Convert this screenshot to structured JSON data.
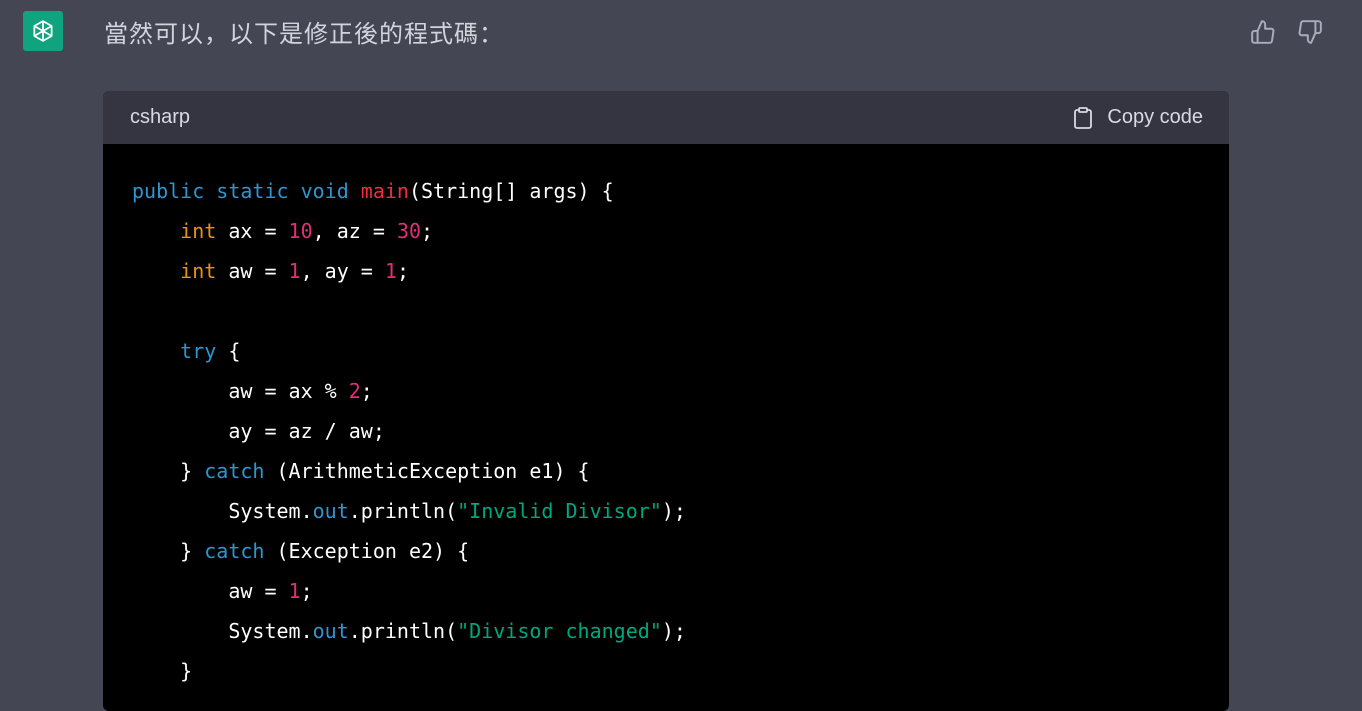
{
  "message": {
    "text": "當然可以，以下是修正後的程式碼："
  },
  "colors": {
    "avatar_bg": "#10a37f",
    "page_bg": "#444654",
    "header_bg": "#343541",
    "code_bg": "#000000"
  },
  "icons": {
    "avatar": "openai-logo-icon",
    "like": "thumbs-up-icon",
    "dislike": "thumbs-down-icon",
    "copy": "clipboard-icon"
  },
  "code_block": {
    "language": "csharp",
    "copy_label": "Copy code",
    "lines": [
      [
        {
          "t": "public static void",
          "c": "kw"
        },
        {
          "t": " "
        },
        {
          "t": "main",
          "c": "ty"
        },
        {
          "t": "(String[] args) {"
        }
      ],
      [
        {
          "t": "    "
        },
        {
          "t": "int",
          "c": "ty-int"
        },
        {
          "t": " ax = "
        },
        {
          "t": "10",
          "c": "num"
        },
        {
          "t": ", az = "
        },
        {
          "t": "30",
          "c": "num"
        },
        {
          "t": ";"
        }
      ],
      [
        {
          "t": "    "
        },
        {
          "t": "int",
          "c": "ty-int"
        },
        {
          "t": " aw = "
        },
        {
          "t": "1",
          "c": "num"
        },
        {
          "t": ", ay = "
        },
        {
          "t": "1",
          "c": "num"
        },
        {
          "t": ";"
        }
      ],
      [
        {
          "t": ""
        }
      ],
      [
        {
          "t": "    "
        },
        {
          "t": "try",
          "c": "kw"
        },
        {
          "t": " {"
        }
      ],
      [
        {
          "t": "        aw = ax % "
        },
        {
          "t": "2",
          "c": "num"
        },
        {
          "t": ";"
        }
      ],
      [
        {
          "t": "        ay = az / aw;"
        }
      ],
      [
        {
          "t": "    } "
        },
        {
          "t": "catch",
          "c": "kw"
        },
        {
          "t": " (ArithmeticException e1) {"
        }
      ],
      [
        {
          "t": "        System."
        },
        {
          "t": "out",
          "c": "kw"
        },
        {
          "t": ".println("
        },
        {
          "t": "\"Invalid Divisor\"",
          "c": "str"
        },
        {
          "t": ");"
        }
      ],
      [
        {
          "t": "    } "
        },
        {
          "t": "catch",
          "c": "kw"
        },
        {
          "t": " (Exception e2) {"
        }
      ],
      [
        {
          "t": "        aw = "
        },
        {
          "t": "1",
          "c": "num"
        },
        {
          "t": ";"
        }
      ],
      [
        {
          "t": "        System."
        },
        {
          "t": "out",
          "c": "kw"
        },
        {
          "t": ".println("
        },
        {
          "t": "\"Divisor changed\"",
          "c": "str"
        },
        {
          "t": ");"
        }
      ],
      [
        {
          "t": "    }"
        }
      ]
    ]
  }
}
